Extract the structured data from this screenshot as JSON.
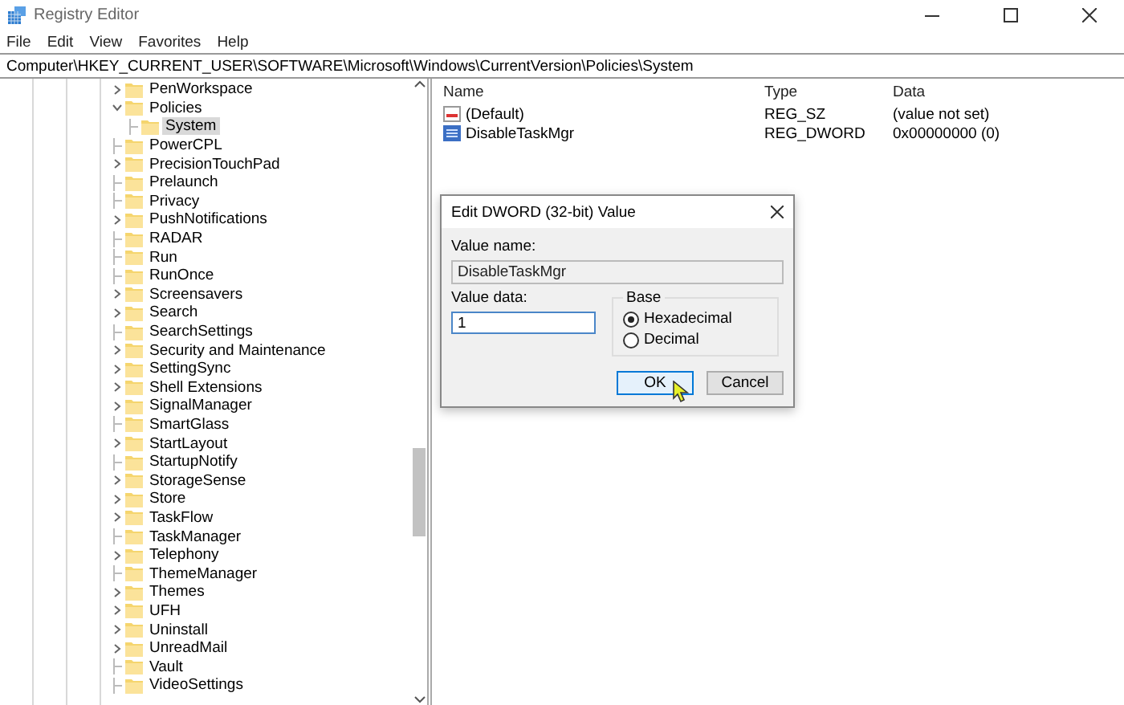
{
  "window": {
    "title": "Registry Editor"
  },
  "menu": [
    "File",
    "Edit",
    "View",
    "Favorites",
    "Help"
  ],
  "address": "Computer\\HKEY_CURRENT_USER\\SOFTWARE\\Microsoft\\Windows\\CurrentVersion\\Policies\\System",
  "tree": [
    {
      "label": "PenWorkspace",
      "expandable": true,
      "expanded": false,
      "selected": false
    },
    {
      "label": "Policies",
      "expandable": true,
      "expanded": true,
      "selected": false,
      "children": [
        {
          "label": "System",
          "expandable": false,
          "selected": true
        }
      ]
    },
    {
      "label": "PowerCPL",
      "expandable": false,
      "selected": false
    },
    {
      "label": "PrecisionTouchPad",
      "expandable": true,
      "expanded": false,
      "selected": false
    },
    {
      "label": "Prelaunch",
      "expandable": false,
      "selected": false
    },
    {
      "label": "Privacy",
      "expandable": false,
      "selected": false
    },
    {
      "label": "PushNotifications",
      "expandable": true,
      "expanded": false,
      "selected": false
    },
    {
      "label": "RADAR",
      "expandable": false,
      "selected": false
    },
    {
      "label": "Run",
      "expandable": false,
      "selected": false
    },
    {
      "label": "RunOnce",
      "expandable": false,
      "selected": false
    },
    {
      "label": "Screensavers",
      "expandable": true,
      "expanded": false,
      "selected": false
    },
    {
      "label": "Search",
      "expandable": true,
      "expanded": false,
      "selected": false
    },
    {
      "label": "SearchSettings",
      "expandable": false,
      "selected": false
    },
    {
      "label": "Security and Maintenance",
      "expandable": true,
      "expanded": false,
      "selected": false
    },
    {
      "label": "SettingSync",
      "expandable": true,
      "expanded": false,
      "selected": false
    },
    {
      "label": "Shell Extensions",
      "expandable": true,
      "expanded": false,
      "selected": false
    },
    {
      "label": "SignalManager",
      "expandable": true,
      "expanded": false,
      "selected": false
    },
    {
      "label": "SmartGlass",
      "expandable": false,
      "selected": false
    },
    {
      "label": "StartLayout",
      "expandable": true,
      "expanded": false,
      "selected": false
    },
    {
      "label": "StartupNotify",
      "expandable": false,
      "selected": false
    },
    {
      "label": "StorageSense",
      "expandable": true,
      "expanded": false,
      "selected": false
    },
    {
      "label": "Store",
      "expandable": true,
      "expanded": false,
      "selected": false
    },
    {
      "label": "TaskFlow",
      "expandable": true,
      "expanded": false,
      "selected": false
    },
    {
      "label": "TaskManager",
      "expandable": false,
      "selected": false
    },
    {
      "label": "Telephony",
      "expandable": true,
      "expanded": false,
      "selected": false
    },
    {
      "label": "ThemeManager",
      "expandable": false,
      "selected": false
    },
    {
      "label": "Themes",
      "expandable": true,
      "expanded": false,
      "selected": false
    },
    {
      "label": "UFH",
      "expandable": true,
      "expanded": false,
      "selected": false
    },
    {
      "label": "Uninstall",
      "expandable": true,
      "expanded": false,
      "selected": false
    },
    {
      "label": "UnreadMail",
      "expandable": true,
      "expanded": false,
      "selected": false
    },
    {
      "label": "Vault",
      "expandable": false,
      "selected": false
    },
    {
      "label": "VideoSettings",
      "expandable": false,
      "selected": false
    }
  ],
  "values": {
    "columns": [
      "Name",
      "Type",
      "Data"
    ],
    "rows": [
      {
        "kind": "string",
        "name": "(Default)",
        "type": "REG_SZ",
        "data": "(value not set)"
      },
      {
        "kind": "binary",
        "name": "DisableTaskMgr",
        "type": "REG_DWORD",
        "data": "0x00000000 (0)"
      }
    ]
  },
  "dialog": {
    "title": "Edit DWORD (32-bit) Value",
    "value_name_label": "Value name:",
    "value_name": "DisableTaskMgr",
    "value_data_label": "Value data:",
    "value_data": "1",
    "base_label": "Base",
    "base_options": [
      {
        "label": "Hexadecimal",
        "selected": true
      },
      {
        "label": "Decimal",
        "selected": false
      }
    ],
    "buttons": [
      {
        "label": "OK",
        "focused": true
      },
      {
        "label": "Cancel",
        "focused": false
      }
    ]
  }
}
